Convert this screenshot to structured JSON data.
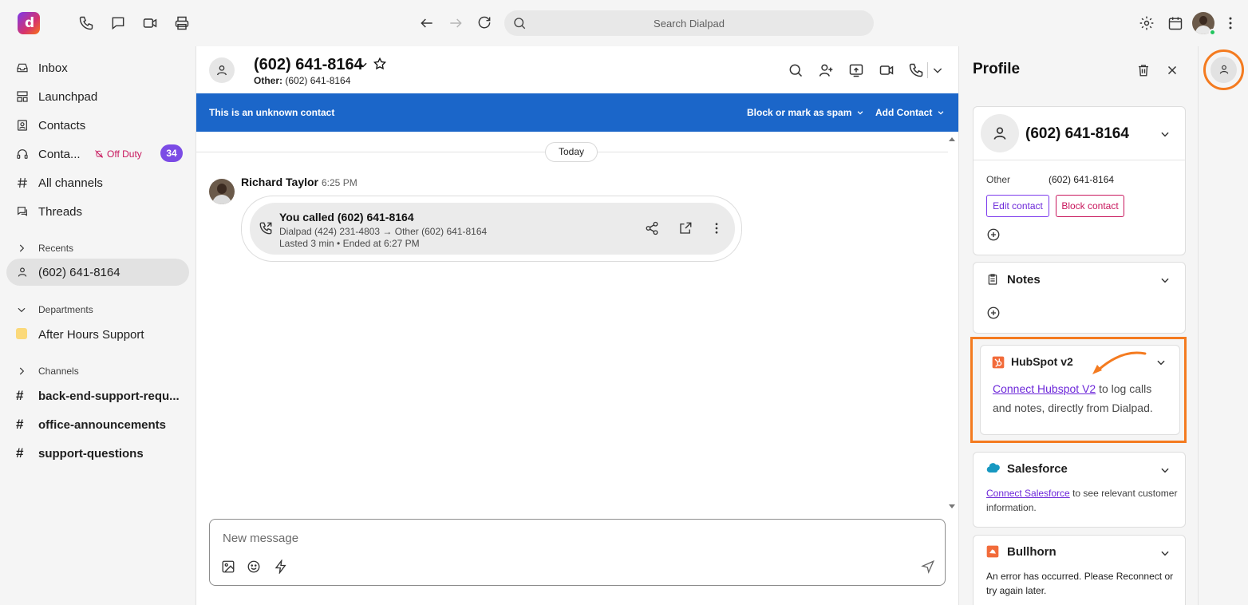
{
  "topbar": {
    "logo_letter": "d",
    "search_placeholder": "Search Dialpad"
  },
  "sidebar": {
    "items": [
      {
        "label": "Inbox",
        "icon": "inbox-icon"
      },
      {
        "label": "Launchpad",
        "icon": "launchpad-icon"
      },
      {
        "label": "Contacts",
        "icon": "contacts-icon"
      },
      {
        "label": "Conta...",
        "icon": "headset-icon"
      },
      {
        "label": "All channels",
        "icon": "hash-icon"
      },
      {
        "label": "Threads",
        "icon": "threads-icon"
      }
    ],
    "off_duty": "Off Duty",
    "badge_count": "34",
    "recents_label": "Recents",
    "recent_item": "(602) 641-8164",
    "departments_label": "Departments",
    "department_item": "After Hours Support",
    "channels_label": "Channels",
    "channels": [
      "back-end-support-requ...",
      "office-announcements",
      "support-questions"
    ]
  },
  "conversation": {
    "title": "(602) 641-8164",
    "subtitle_label": "Other:",
    "subtitle_value": "(602) 641-8164",
    "banner_text": "This is an unknown contact",
    "block_label": "Block or mark as spam",
    "add_contact_label": "Add Contact",
    "date_divider": "Today",
    "message": {
      "sender": "Richard Taylor",
      "time": "6:25 PM",
      "call_title": "You called (602) 641-8164",
      "call_route": "Dialpad (424) 231-4803 → Other (602) 641-8164",
      "call_duration": "Lasted 3 min • Ended at 6:27 PM"
    },
    "composer_placeholder": "New message"
  },
  "profile": {
    "title": "Profile",
    "contact_number": "(602) 641-8164",
    "other_label": "Other",
    "other_value": "(602) 641-8164",
    "edit_contact": "Edit contact",
    "block_contact": "Block contact",
    "notes_title": "Notes",
    "hubspot_title": "HubSpot v2",
    "hubspot_link": "Connect Hubspot V2",
    "hubspot_text": " to log calls and notes, directly from Dialpad.",
    "salesforce_title": "Salesforce",
    "salesforce_link": "Connect Salesforce",
    "salesforce_text": " to see relevant customer information.",
    "bullhorn_title": "Bullhorn",
    "bullhorn_text": "An error has occurred. Please Reconnect or try again later."
  },
  "colors": {
    "banner": "#1b66c9",
    "accent_purple": "#7b4be5",
    "off_duty": "#c8175d",
    "highlight": "#f47b20"
  }
}
